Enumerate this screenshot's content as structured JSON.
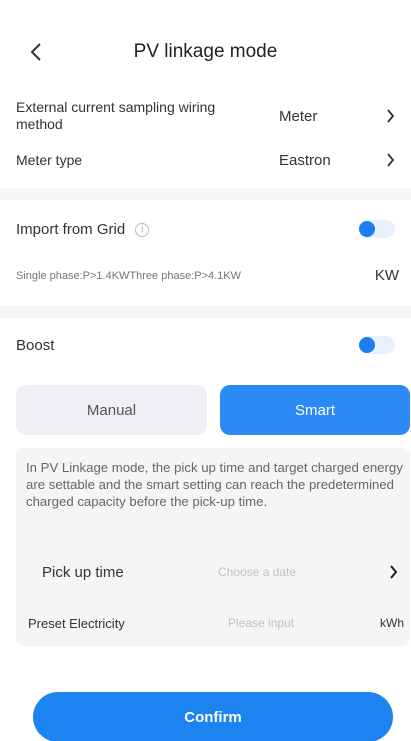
{
  "header": {
    "title": "PV linkage mode"
  },
  "settings": {
    "wiring": {
      "label_line1": "External current sampling wiring",
      "label_line2": "method",
      "value": "Meter"
    },
    "meter_type": {
      "label": "Meter type",
      "value": "Eastron"
    }
  },
  "import_from_grid": {
    "label": "Import from Grid",
    "enabled": true,
    "input_placeholder": "Single phase:P>1.4KWThree phase:P>4.1KW",
    "unit": "KW"
  },
  "boost": {
    "label": "Boost",
    "enabled": true,
    "tabs": {
      "manual": "Manual",
      "smart": "Smart"
    },
    "selected_tab": "Smart",
    "description": "In PV Linkage mode, the pick up time and target charged energy are settable and the smart setting can reach the predetermined charged capacity before the pick-up time.",
    "pickup_time": {
      "label": "Pick up time",
      "placeholder": "Choose a date"
    },
    "preset_electricity": {
      "label": "Preset Electricity",
      "placeholder": "Please input",
      "unit": "kWh"
    }
  },
  "confirm_label": "Confirm",
  "colors": {
    "accent": "#2b8af4",
    "divider": "#f5f6f8",
    "panel": "#f4f5f7"
  },
  "icons": {
    "back": "chevron-left-icon",
    "chevron": "chevron-right-icon",
    "info": "info-icon"
  }
}
